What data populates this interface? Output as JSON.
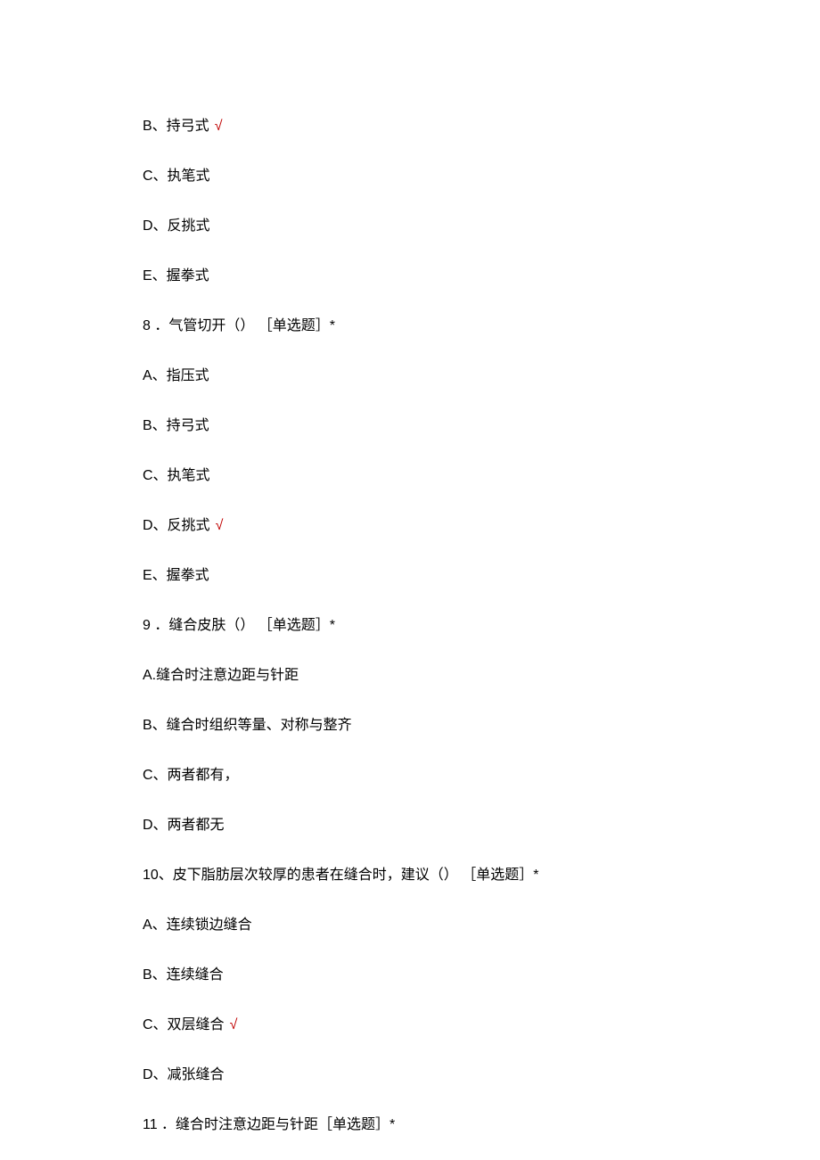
{
  "lines": [
    {
      "text": "B、持弓式",
      "correct": true
    },
    {
      "text": "C、执笔式",
      "correct": false
    },
    {
      "text": "D、反挑式",
      "correct": false
    },
    {
      "text": "E、握拳式",
      "correct": false
    },
    {
      "text": "8 ．气管切开（） ［单选题］*",
      "correct": false
    },
    {
      "text": "A、指压式",
      "correct": false
    },
    {
      "text": "B、持弓式",
      "correct": false
    },
    {
      "text": "C、执笔式",
      "correct": false
    },
    {
      "text": "D、反挑式",
      "correct": true
    },
    {
      "text": "E、握拳式",
      "correct": false
    },
    {
      "text": "9 ．缝合皮肤（） ［单选题］*",
      "correct": false
    },
    {
      "text": "A.缝合时注意边距与针距",
      "correct": false
    },
    {
      "text": "B、缝合时组织等量、对称与整齐",
      "correct": false
    },
    {
      "text": "C、两者都有，",
      "correct": false
    },
    {
      "text": "D、两者都无",
      "correct": false
    },
    {
      "text": "10、皮下脂肪层次较厚的患者在缝合时，建议（） ［单选题］*",
      "correct": false
    },
    {
      "text": "A、连续锁边缝合",
      "correct": false
    },
    {
      "text": "B、连续缝合",
      "correct": false
    },
    {
      "text": "C、双层缝合",
      "correct": true
    },
    {
      "text": "D、减张缝合",
      "correct": false
    },
    {
      "text": "11 ．缝合时注意边距与针距［单选题］*",
      "correct": false
    }
  ],
  "checkmark": "√"
}
